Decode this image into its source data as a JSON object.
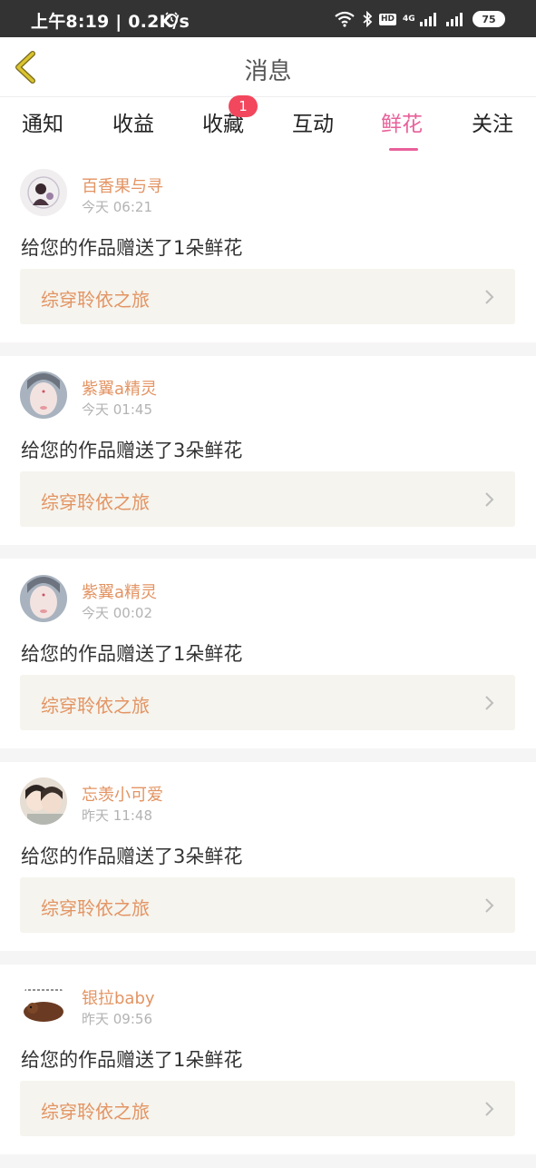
{
  "status_bar": {
    "time": "上午8:19 | 0.2K/s",
    "hd": "HD",
    "network": "4G",
    "battery": "75"
  },
  "header": {
    "title": "消息"
  },
  "tabs": [
    {
      "label": "通知"
    },
    {
      "label": "收益"
    },
    {
      "label": "收藏",
      "badge": "1"
    },
    {
      "label": "互动"
    },
    {
      "label": "鲜花",
      "active": true
    },
    {
      "label": "关注"
    }
  ],
  "notifications": [
    {
      "username": "百香果与寻",
      "time": "今天 06:21",
      "message": "给您的作品赠送了1朵鲜花",
      "work_title": "综穿聆依之旅"
    },
    {
      "username": "紫翼a精灵",
      "time": "今天 01:45",
      "message": "给您的作品赠送了3朵鲜花",
      "work_title": "综穿聆依之旅"
    },
    {
      "username": "紫翼a精灵",
      "time": "今天 00:02",
      "message": "给您的作品赠送了1朵鲜花",
      "work_title": "综穿聆依之旅"
    },
    {
      "username": "忘羡小可爱",
      "time": "昨天 11:48",
      "message": "给您的作品赠送了3朵鲜花",
      "work_title": "综穿聆依之旅"
    },
    {
      "username": "银拉baby",
      "time": "昨天 09:56",
      "message": "给您的作品赠送了1朵鲜花",
      "work_title": "综穿聆依之旅"
    }
  ],
  "colors": {
    "accent_pink": "#e8609a",
    "username_orange": "#e39463",
    "badge_red": "#f2475d",
    "back_icon_yellow": "#d9c430"
  }
}
